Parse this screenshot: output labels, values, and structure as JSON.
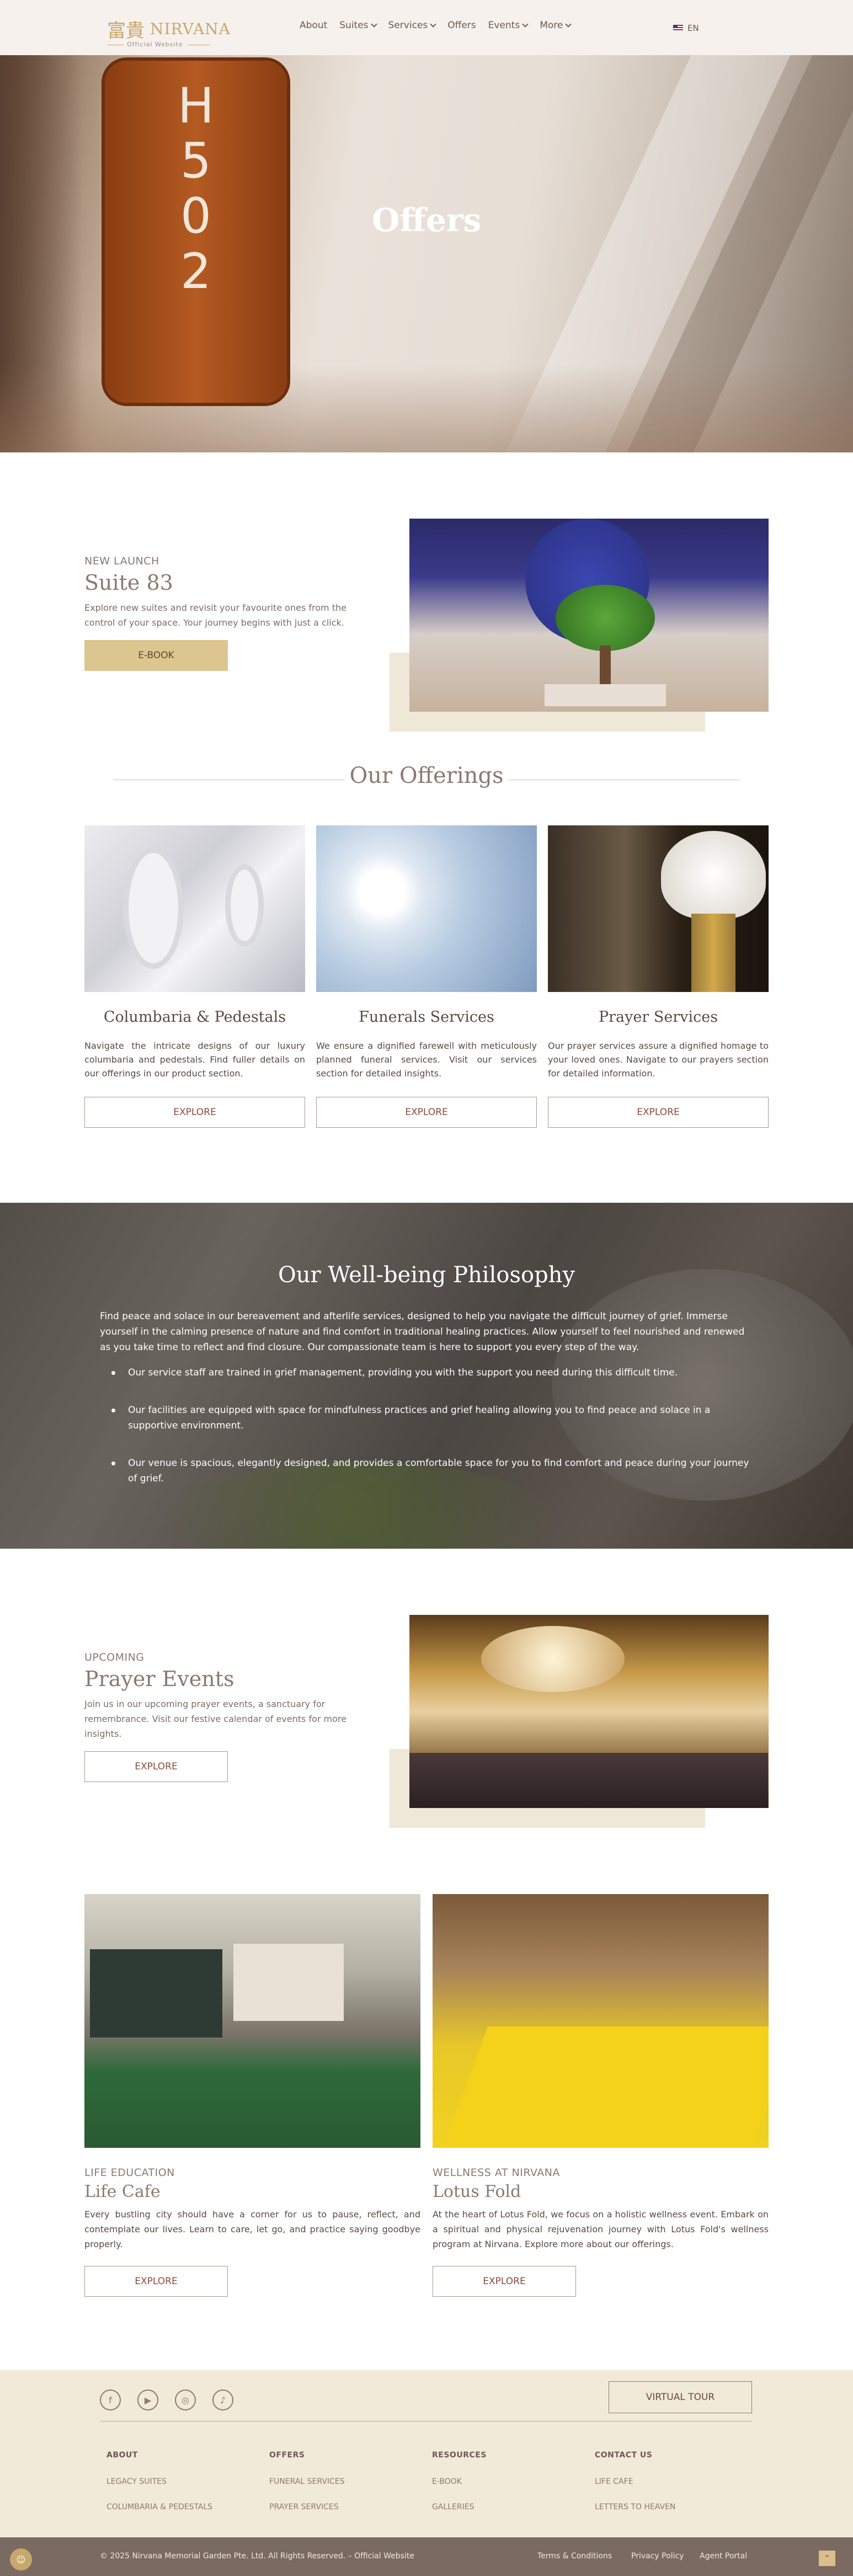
{
  "header": {
    "logo_cn": "富貴",
    "logo_en": "NIRVANA",
    "logo_sub": "Official Website",
    "nav": [
      {
        "label": "About",
        "dropdown": false
      },
      {
        "label": "Suites",
        "dropdown": true
      },
      {
        "label": "Services",
        "dropdown": true
      },
      {
        "label": "Offers",
        "dropdown": false
      },
      {
        "label": "Events",
        "dropdown": true
      },
      {
        "label": "More",
        "dropdown": true
      }
    ],
    "lang": "EN"
  },
  "hero": {
    "title": "Offers",
    "plaque_chars": [
      "H",
      "5",
      "0",
      "2"
    ]
  },
  "new_launch": {
    "kicker": "NEW LAUNCH",
    "title": "Suite 83",
    "text": "Explore new suites and revisit your favourite ones from the control of your space. Your journey begins with just a click.",
    "button": "E-BOOK"
  },
  "offerings": {
    "title": "Our Offerings",
    "cards": [
      {
        "title": "Columbaria & Pedestals",
        "text": "Navigate the intricate designs of our luxury columbaria and pedestals. Find fuller details on our offerings in our product section.",
        "button": "EXPLORE"
      },
      {
        "title": "Funerals Services",
        "text": "We ensure a dignified farewell with meticulously planned funeral services. Visit our services section for detailed insights.",
        "button": "EXPLORE"
      },
      {
        "title": "Prayer Services",
        "text": "Our prayer services assure a dignified homage to your loved ones. Navigate to our prayers section for detailed information.",
        "button": "EXPLORE"
      }
    ]
  },
  "philosophy": {
    "title": "Our Well-being Philosophy",
    "intro": "Find peace and solace in our bereavement and afterlife services, designed to help you navigate the difficult journey of grief. Immerse yourself in the calming presence of nature and find comfort in traditional healing practices. Allow yourself to feel nourished and renewed as you take time to reflect and find closure. Our compassionate team is here to support you every step of the way.",
    "points": [
      "Our service staff are trained in grief management, providing you with the support you need during this difficult time.",
      "Our facilities are equipped with space for mindfulness practices and grief healing allowing you to find peace and solace in a supportive environment.",
      "Our venue is spacious, elegantly designed, and provides a comfortable space for you to find comfort and peace during your journey of grief."
    ]
  },
  "prayer_events": {
    "kicker": "UPCOMING",
    "title": "Prayer Events",
    "text": "Join us in our upcoming prayer events, a sanctuary for remembrance. Visit our festive calendar of events for more insights.",
    "button": "EXPLORE"
  },
  "life_cafe": {
    "kicker": "LIFE EDUCATION",
    "title": "Life Cafe",
    "text": "Every bustling city should have a corner for us to pause, reflect, and contemplate our lives. Learn to care, let go, and practice saying goodbye properly.",
    "button": "EXPLORE"
  },
  "lotus_fold": {
    "kicker": "WELLNESS AT NIRVANA",
    "title": "Lotus Fold",
    "text": "At the heart of Lotus Fold, we focus on a holistic wellness event. Embark on a spiritual and physical rejuvenation journey with Lotus Fold's wellness program at Nirvana. Explore more about our offerings.",
    "button": "EXPLORE"
  },
  "footer": {
    "social_icons": [
      "facebook-icon",
      "youtube-icon",
      "instagram-icon",
      "tiktok-icon"
    ],
    "virtual_tour": "VIRTUAL TOUR",
    "columns": [
      {
        "heading": "ABOUT",
        "links": [
          "LEGACY SUITES",
          "COLUMBARIA & PEDESTALS"
        ]
      },
      {
        "heading": "OFFERS",
        "links": [
          "FUNERAL SERVICES",
          "PRAYER SERVICES"
        ]
      },
      {
        "heading": "RESOURCES",
        "links": [
          "E-BOOK",
          "GALLERIES"
        ]
      },
      {
        "heading": "CONTACT US",
        "links": [
          "LIFE CAFE",
          "LETTERS TO HEAVEN"
        ]
      }
    ],
    "copyright": "© 2025 Nirvana Memorial Garden Pte. Ltd. All Rights Reserved. – Official Website",
    "bottom_links": [
      "Terms & Conditions",
      "Privacy Policy",
      "Agent Portal"
    ]
  },
  "colors": {
    "gold": "#c8a86a",
    "button_gold": "#ddc58f",
    "footer_bg": "#f2ead8",
    "bottom_bar": "#7a6a62"
  }
}
